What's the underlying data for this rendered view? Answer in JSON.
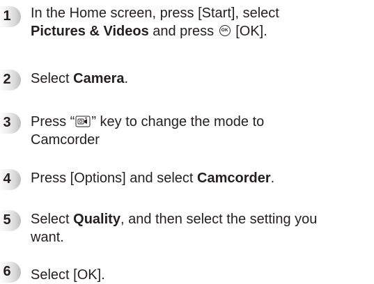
{
  "steps": [
    {
      "number": "1",
      "line1_before": "In the Home screen, press [Start], select",
      "line2_bold": "Pictures & Videos",
      "line2_mid": " and press ",
      "ok_icon_label": "OK",
      "line2_after": " [OK]."
    },
    {
      "number": "2",
      "before": "Select ",
      "bold": "Camera",
      "after": "."
    },
    {
      "number": "3",
      "before": "Press “",
      "key_icon": "camera-mode-key-icon",
      "after": "” key to change the mode to",
      "line2": "Camcorder"
    },
    {
      "number": "4",
      "before": "Press [Options] and select ",
      "bold": "Camcorder",
      "after": "."
    },
    {
      "number": "5",
      "before": "Select ",
      "bold": "Quality",
      "after": ", and then select the setting you",
      "line2": "want."
    },
    {
      "number": "6",
      "text": "Select [OK]."
    }
  ]
}
